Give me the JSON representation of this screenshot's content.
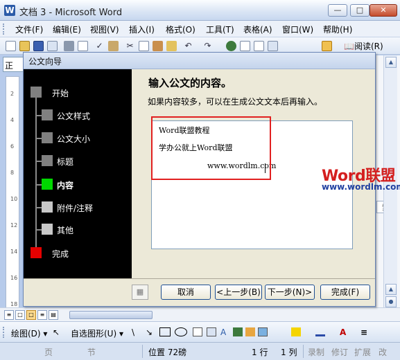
{
  "window": {
    "title": "文档 3 - Microsoft Word",
    "app_icon": "W"
  },
  "menu": [
    "文件(F)",
    "编辑(E)",
    "视图(V)",
    "插入(I)",
    "格式(O)",
    "工具(T)",
    "表格(A)",
    "窗口(W)",
    "帮助(H)"
  ],
  "toolbar": {
    "read_label": "阅读(R)"
  },
  "style_box": "正",
  "ruler_marks": [
    "2",
    "4",
    "6",
    "8",
    "10",
    "12",
    "14",
    "16",
    "18"
  ],
  "dialog": {
    "title": "公文向导",
    "steps": [
      {
        "label": "开始",
        "color": "#808080"
      },
      {
        "label": "公文样式",
        "color": "#808080"
      },
      {
        "label": "公文大小",
        "color": "#808080"
      },
      {
        "label": "标题",
        "color": "#808080"
      },
      {
        "label": "内容",
        "color": "#00d800",
        "active": true
      },
      {
        "label": "附件/注释",
        "color": "#c8c8c8"
      },
      {
        "label": "其他",
        "color": "#c8c8c8"
      },
      {
        "label": "完成",
        "color": "#e60000"
      }
    ],
    "heading": "输入公文的内容。",
    "hint": "如果内容较多，可以在生成公文文本后再输入。",
    "content_lines": [
      "Word联盟教程",
      "学办公就上Word联盟",
      "www.wordlm.com"
    ],
    "buttons": {
      "cancel": "取消",
      "back": "<上一步(B)",
      "next": "下一步(N)>",
      "finish": "完成(F)"
    }
  },
  "watermark": {
    "brand_word": "Word",
    "brand_cn": "联盟",
    "url": "www.wordlm.com"
  },
  "right_peek": "索",
  "drawbar": {
    "draw_label": "绘图(D)",
    "autoshape_label": "自选图形(U)"
  },
  "statusbar": {
    "page": "页",
    "section": "节",
    "position": "位置 72磅",
    "line": "1 行",
    "col": "1 列",
    "rec": "录制",
    "trk": "修订",
    "ext": "扩展",
    "ovr": "改"
  }
}
